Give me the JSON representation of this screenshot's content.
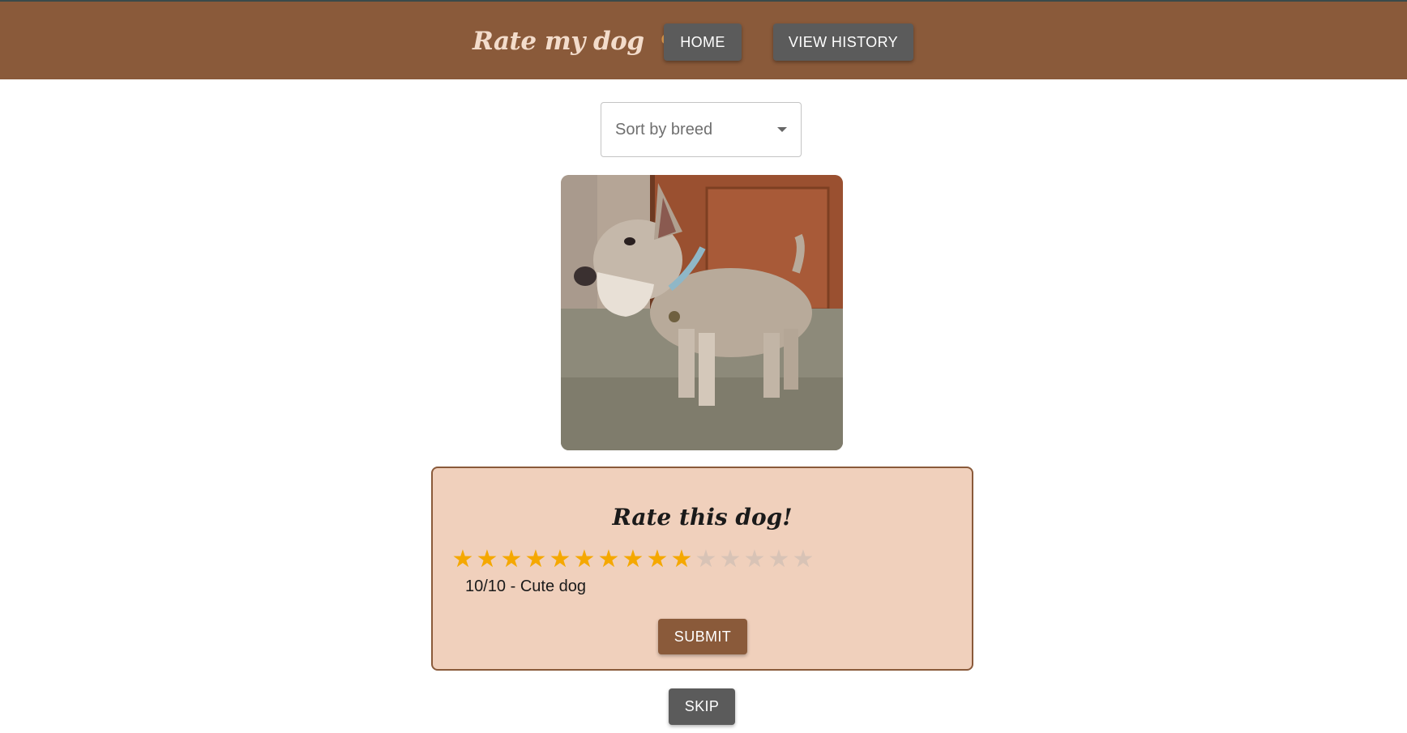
{
  "header": {
    "brand_title": "Rate my dog",
    "brand_icon": "dog-icon",
    "nav": {
      "home_label": "HOME",
      "history_label": "VIEW HISTORY"
    }
  },
  "filter": {
    "sort_placeholder": "Sort by breed"
  },
  "photo": {
    "subject_icon": "dog-photo"
  },
  "rating_card": {
    "title": "Rate this dog!",
    "stars_total": 15,
    "stars_filled": 10,
    "rating_text": "10/10 - Cute dog",
    "submit_label": "SUBMIT"
  },
  "skip_label": "SKIP",
  "colors": {
    "header_bg": "#8a5a3a",
    "card_bg": "#f0d0bc",
    "button_gray": "#5b5b5b",
    "button_brown": "#8a5a3a",
    "star_on": "#f5a800",
    "star_off": "#d8c3b6"
  }
}
